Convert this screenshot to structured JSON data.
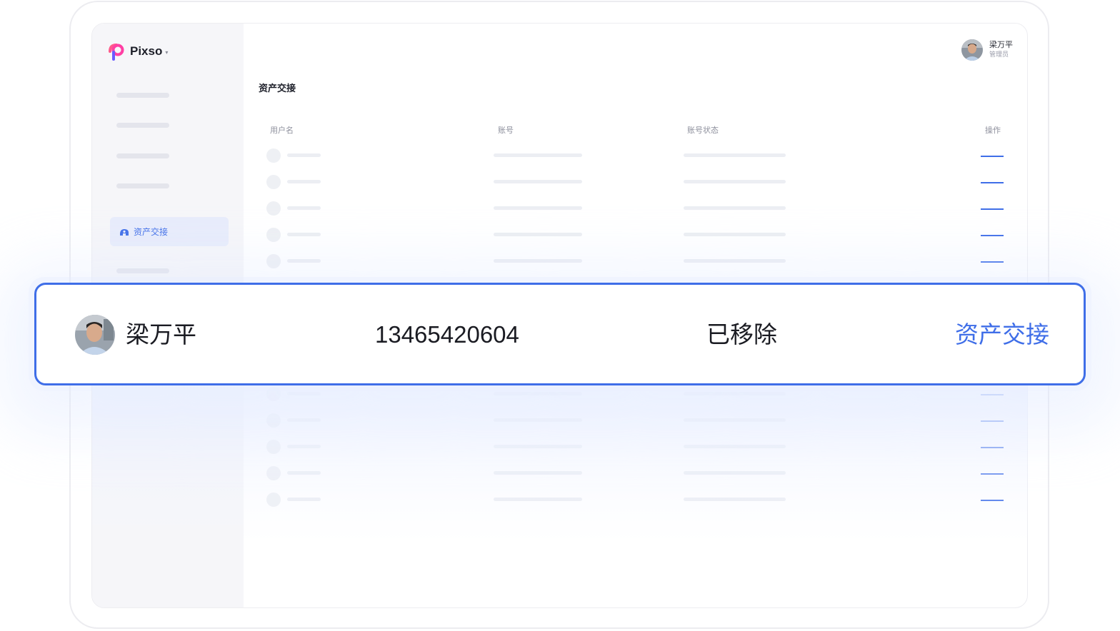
{
  "app": {
    "name": "Pixso",
    "caret": "▾"
  },
  "user": {
    "name": "梁万平",
    "role": "管理员"
  },
  "sidebar": {
    "active_item": {
      "label": "资产交接",
      "icon": "handover-icon"
    }
  },
  "page": {
    "title": "资产交接"
  },
  "table": {
    "columns": [
      "用户名",
      "账号",
      "账号状态",
      "操作"
    ],
    "highlighted_row": {
      "username": "梁万平",
      "account": "13465420604",
      "status": "已移除",
      "action": "资产交接"
    }
  },
  "colors": {
    "accent": "#3f6ee8",
    "sidebar_bg": "#f6f6f9",
    "placeholder": "#eceef3"
  }
}
